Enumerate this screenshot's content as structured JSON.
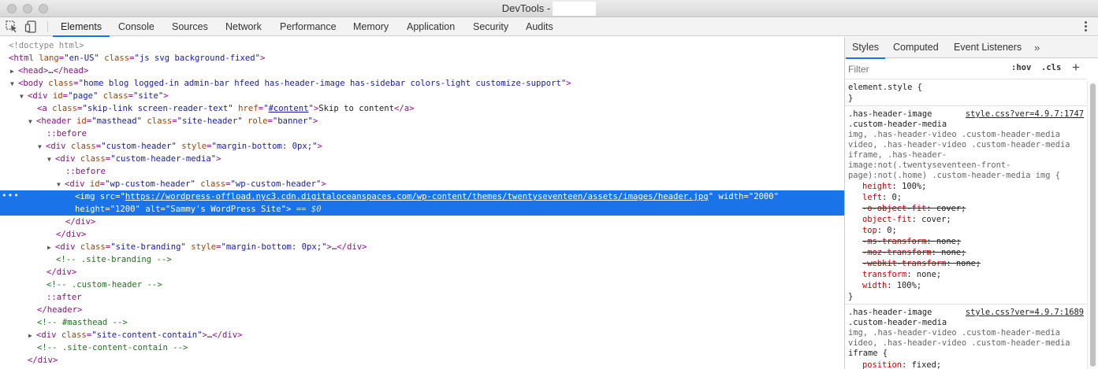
{
  "window": {
    "title": "DevTools -"
  },
  "tabs": [
    "Elements",
    "Console",
    "Sources",
    "Network",
    "Performance",
    "Memory",
    "Application",
    "Security",
    "Audits"
  ],
  "active_tab": "Elements",
  "elements_tree": {
    "l0": "<!doctype html>",
    "l1": {
      "open": "<html",
      "a1n": "lang",
      "a1v": "\"en-US\"",
      "a2n": "class",
      "a2v": "\"js svg background-fixed\"",
      "close": ">"
    },
    "l2": {
      "open": "<head>",
      "ellipsis": "…",
      "close": "</head>"
    },
    "l3": {
      "open": "<body",
      "an": "class",
      "av": "\"home blog logged-in admin-bar hfeed has-header-image has-sidebar colors-light customize-support\"",
      "close": ">"
    },
    "l4": {
      "open": "<div",
      "a1n": "id",
      "a1v": "\"page\"",
      "a2n": "class",
      "a2v": "\"site\"",
      "close": ">"
    },
    "l5": {
      "open": "<a",
      "a1n": "class",
      "a1v": "\"skip-link screen-reader-text\"",
      "a2n": "href",
      "a2v_pre": "\"",
      "a2v_link": "#content",
      "a2v_post": "\"",
      "gt": ">",
      "text": "Skip to content",
      "close": "</a>"
    },
    "l6": {
      "open": "<header",
      "a1n": "id",
      "a1v": "\"masthead\"",
      "a2n": "class",
      "a2v": "\"site-header\"",
      "a3n": "role",
      "a3v": "\"banner\"",
      "close": ">"
    },
    "l7": "::before",
    "l8": {
      "open": "<div",
      "a1n": "class",
      "a1v": "\"custom-header\"",
      "a2n": "style",
      "a2v": "\"margin-bottom: 0px;\"",
      "close": ">"
    },
    "l9": {
      "open": "<div",
      "a1n": "class",
      "a1v": "\"custom-header-media\"",
      "close": ">"
    },
    "l10": "::before",
    "l11": {
      "open": "<div",
      "a1n": "id",
      "a1v": "\"wp-custom-header\"",
      "a2n": "class",
      "a2v": "\"wp-custom-header\"",
      "close": ">"
    },
    "l12": {
      "dots": "•••",
      "open": "<img",
      "a1n": "src",
      "a1v_pre": "\"",
      "a1v_link": "https://wordpress-offload.nyc3.cdn.digitaloceanspaces.com/wp-content/themes/twentyseventeen/assets/images/header.jpg",
      "a1v_post": "\"",
      "a2n": "width",
      "a2v": "\"2000\""
    },
    "l13": {
      "a1n": "height",
      "a1v": "\"1200\"",
      "a2n": "alt",
      "a2v": "\"Sammy's WordPress Site\"",
      "close": ">",
      "eq": "== $0"
    },
    "l14": "</div>",
    "l15": "</div>",
    "l16": {
      "open": "<div",
      "a1n": "class",
      "a1v": "\"site-branding\"",
      "a2n": "style",
      "a2v": "\"margin-bottom: 0px;\"",
      "gt": ">",
      "ellipsis": "…",
      "close": "</div>"
    },
    "l17": "<!-- .site-branding -->",
    "l18": "</div>",
    "l19": "<!-- .custom-header -->",
    "l20": "::after",
    "l21": "</header>",
    "l22": "<!-- #masthead -->",
    "l23": {
      "open": "<div",
      "a1n": "class",
      "a1v": "\"site-content-contain\"",
      "gt": ">",
      "ellipsis": "…",
      "close": "</div>"
    },
    "l24": "<!-- .site-content-contain -->",
    "l25": "</div>"
  },
  "styles_panel": {
    "tabs": [
      "Styles",
      "Computed",
      "Event Listeners"
    ],
    "more": "»",
    "active_tab": "Styles",
    "filter_placeholder": "Filter",
    "hov": ":hov",
    "cls": ".cls",
    "plus": "+",
    "element_style": {
      "selector": "element.style {",
      "close": "}"
    },
    "rule1": {
      "source": "style.css?ver=4.9.7:1747",
      "selector_lines": [
        ".has-header-image",
        ".custom-header-media",
        "img, .has-header-video .custom-header-media",
        "video, .has-header-video .custom-header-media",
        "iframe, .has-header-",
        "image:not(.twentyseventeen-front-",
        "page):not(.home) .custom-header-media img {"
      ],
      "declarations": [
        {
          "name": "height",
          "value": "100%;",
          "struck": false
        },
        {
          "name": "left",
          "value": "0;",
          "struck": false
        },
        {
          "name": "-o-object-fit",
          "value": "cover;",
          "struck": true
        },
        {
          "name": "object-fit",
          "value": "cover;",
          "struck": false
        },
        {
          "name": "top",
          "value": "0;",
          "struck": false
        },
        {
          "name": "-ms-transform",
          "value": "none;",
          "struck": true
        },
        {
          "name": "-moz-transform",
          "value": "none;",
          "struck": true
        },
        {
          "name": "-webkit-transform",
          "value": "none;",
          "struck": true
        },
        {
          "name": "transform",
          "value": "none;",
          "struck": false
        },
        {
          "name": "width",
          "value": "100%;",
          "struck": false
        }
      ],
      "close": "}"
    },
    "rule2": {
      "source": "style.css?ver=4.9.7:1689",
      "selector_lines": [
        ".has-header-image",
        ".custom-header-media",
        "img, .has-header-video .custom-header-media",
        "video, .has-header-video .custom-header-media",
        "iframe {"
      ],
      "declarations": [
        {
          "name": "position",
          "value": "fixed;",
          "struck": false
        }
      ]
    }
  }
}
